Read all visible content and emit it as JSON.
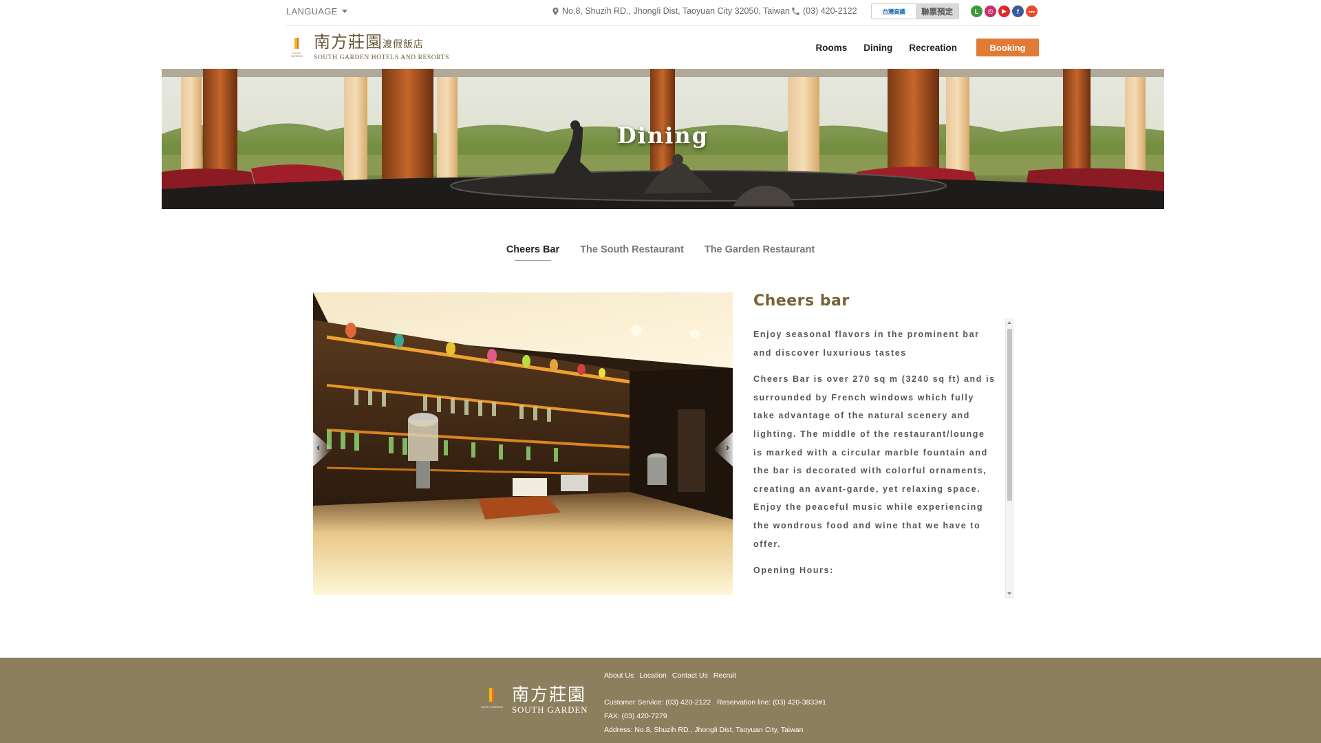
{
  "topbar": {
    "language_label": "LANGUAGE",
    "address": "No.8, Shuzih RD., Jhongli Dist, Taoyuan City 32050, Taiwan",
    "phone": "(03) 420-2122",
    "combo_logo_text": "台灣高鐵",
    "combo_label": "聯票預定",
    "socials": [
      {
        "name": "line",
        "color": "#3a9a3a",
        "glyph": "L"
      },
      {
        "name": "instagram",
        "color": "#c8306b",
        "glyph": "◎"
      },
      {
        "name": "youtube",
        "color": "#e02a2a",
        "glyph": "▶"
      },
      {
        "name": "facebook",
        "color": "#3b5a9a",
        "glyph": "f"
      },
      {
        "name": "more",
        "color": "#e84a2a",
        "glyph": "•••"
      }
    ]
  },
  "nav": {
    "logo_cn": "南方莊園",
    "logo_cn_small": "渡假飯店",
    "logo_en": "SOUTH GARDEN HOTELS AND RESORTS",
    "links": [
      "Rooms",
      "Dining",
      "Recreation"
    ],
    "booking_label": "Booking",
    "accent_color": "#e07a35"
  },
  "banner": {
    "title": "Dining"
  },
  "tabs": {
    "items": [
      "Cheers Bar",
      "The South Restaurant",
      "The Garden Restaurant"
    ],
    "active": "Cheers Bar"
  },
  "content": {
    "title": "Cheers bar",
    "paragraphs": [
      "Enjoy seasonal flavors in the prominent bar and discover luxurious tastes",
      "Cheers Bar is over 270 sq m (3240 sq ft) and is surrounded by French windows which fully take advantage of the natural scenery and lighting. The middle of the restaurant/lounge is marked with a circular marble fountain and the bar is decorated with colorful ornaments, creating an avant-garde, yet relaxing space. Enjoy the peaceful music while experiencing the wondrous food and wine that we have to offer.",
      "Opening Hours:"
    ],
    "prev_glyph": "‹",
    "next_glyph": "›"
  },
  "footer": {
    "logo_cn": "南方莊園",
    "logo_en": "SOUTH GARDEN",
    "links": [
      "About Us",
      "Location",
      "Contact Us",
      "Recruit"
    ],
    "customer_service": "Customer Service: (03) 420-2122",
    "reservation": "Reservation line: (03) 420-3833#1",
    "fax": "FAX: (03) 420-7279",
    "address": "Address: No.8, Shuzih RD., Jhongli Dist, Taoyuan City, Taiwan",
    "bg_color": "#8c7f5e"
  }
}
